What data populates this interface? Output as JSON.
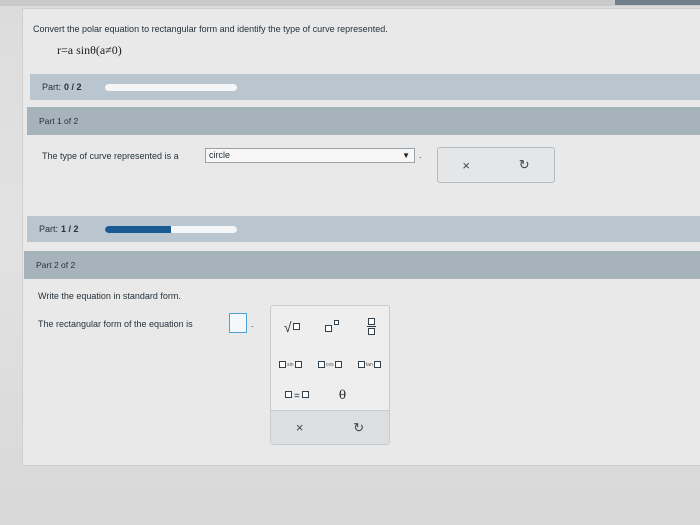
{
  "question": {
    "prompt": "Convert the polar equation to rectangular form and identify the type of curve represented.",
    "equation": "r=a sinθ(a≠0)"
  },
  "part1_bar": {
    "label": "Part:",
    "progress_text": "0 / 2",
    "progress": 0.0
  },
  "part1_header": "Part 1 of 2",
  "part1": {
    "sentence": "The type of curve represented is a",
    "dropdown_value": "circle",
    "period": "."
  },
  "part2_bar": {
    "label": "Part:",
    "progress_text": "1 / 2",
    "progress": 0.5
  },
  "part2_header": "Part 2 of 2",
  "part2": {
    "instruction": "Write the equation in standard form.",
    "sentence": "The rectangular form of the equation is",
    "period": "."
  },
  "actions": {
    "clear": "×",
    "undo": "↻"
  },
  "palette": {
    "sin": "sin",
    "cos": "cos",
    "tan": "tan",
    "eq": "=",
    "theta": "θ",
    "clear": "×",
    "undo": "↻"
  },
  "colors": {
    "progress_fill": "#1a5a92",
    "part_bar": "#b9c5cf",
    "part_header": "#a7b3bb"
  }
}
